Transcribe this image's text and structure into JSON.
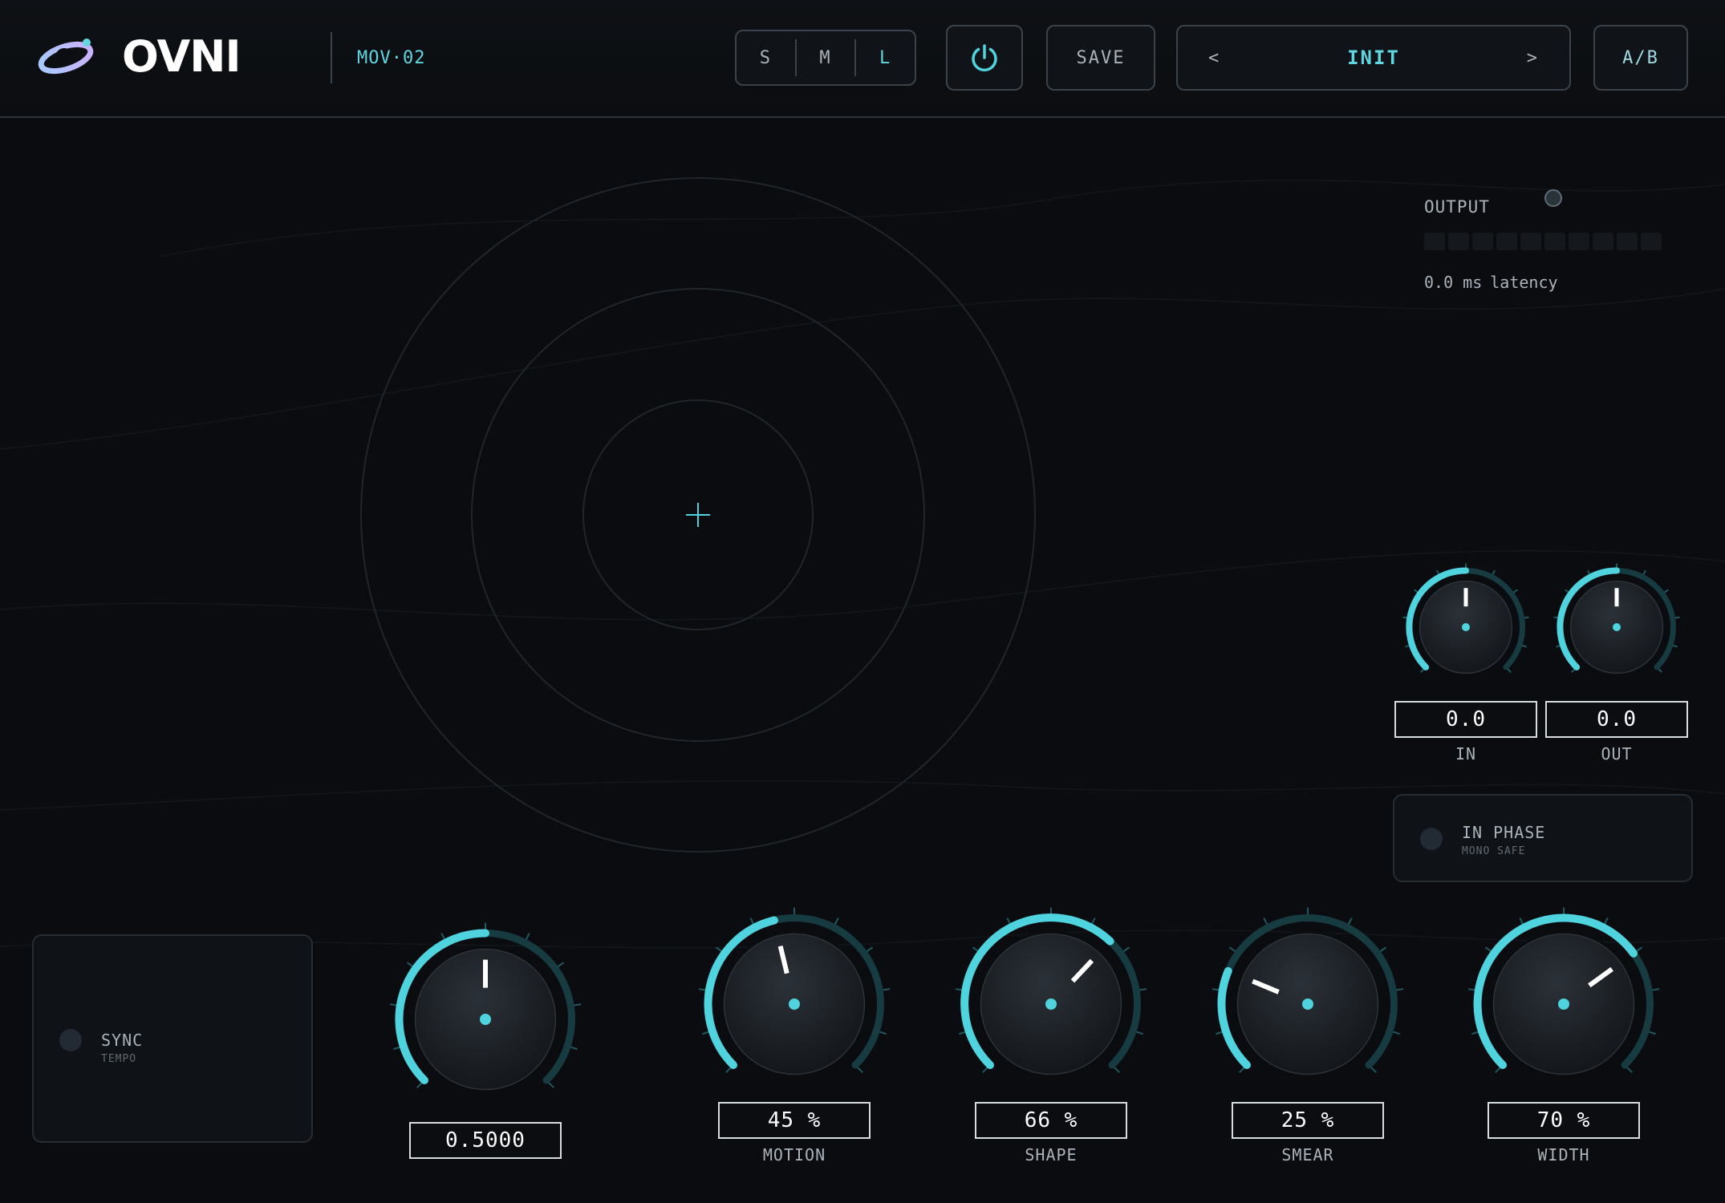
{
  "header": {
    "brand": "OVNI",
    "model": "MOV·02",
    "size_buttons": [
      "S",
      "M",
      "L"
    ],
    "active_size": "L",
    "save_label": "SAVE",
    "preset_prev": "<",
    "preset_name": "INIT",
    "preset_next": ">",
    "ab_label": "A/B"
  },
  "output": {
    "label": "OUTPUT",
    "latency_value": "0.0 ms",
    "latency_unit": "latency",
    "meter_level": 0
  },
  "gain": {
    "in": {
      "value": "0.0",
      "label": "IN"
    },
    "out": {
      "value": "0.0",
      "label": "OUT"
    }
  },
  "in_phase": {
    "title": "IN PHASE",
    "subtitle": "MONO SAFE"
  },
  "sync": {
    "title": "SYNC",
    "subtitle": "TEMPO"
  },
  "rate": {
    "value": "0.5000",
    "level": 0.5
  },
  "knobs": [
    {
      "label": "MOTION",
      "value": "45 %",
      "level": 0.45
    },
    {
      "label": "SHAPE",
      "value": "66 %",
      "level": 0.66
    },
    {
      "label": "SMEAR",
      "value": "25 %",
      "level": 0.25
    },
    {
      "label": "WIDTH",
      "value": "70 %",
      "level": 0.7
    }
  ],
  "colors": {
    "accent": "#4fd3de",
    "panel": "#0f1216",
    "text": "#aab3bb"
  },
  "icons": [
    "ovni-logo-icon",
    "power-icon",
    "crosshair-icon"
  ]
}
